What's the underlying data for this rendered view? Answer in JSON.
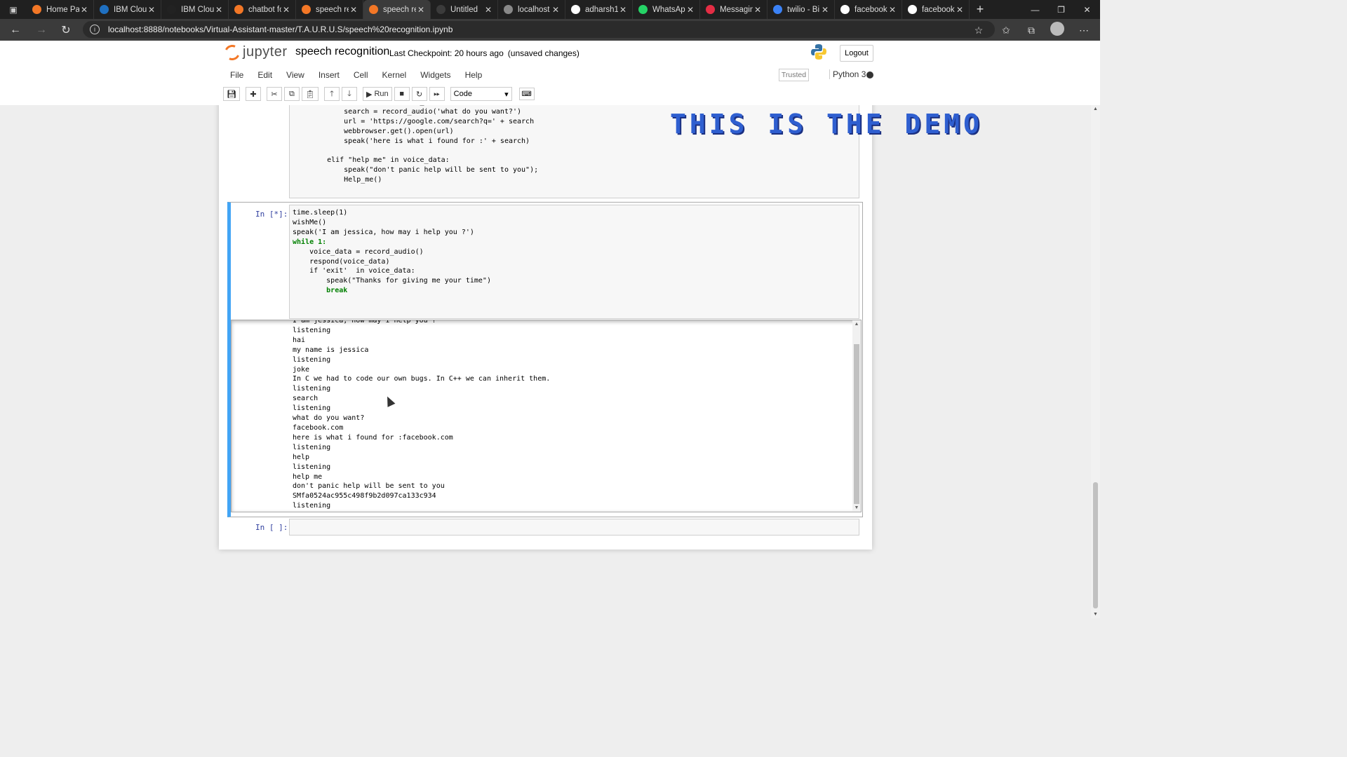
{
  "browser": {
    "tabs": [
      {
        "label": "Home Pa",
        "icon": "jupyter-icon",
        "color": "#f37726",
        "active": false
      },
      {
        "label": "IBM Clou",
        "icon": "ibm-icon",
        "color": "#1f70c1",
        "active": false
      },
      {
        "label": "IBM Clou",
        "icon": "github-icon",
        "color": "#222222",
        "active": false
      },
      {
        "label": "chatbot fo",
        "icon": "jupyter-icon",
        "color": "#f37726",
        "active": false
      },
      {
        "label": "speech re",
        "icon": "notebook-icon",
        "color": "#f37726",
        "active": false
      },
      {
        "label": "speech re",
        "icon": "notebook-icon",
        "color": "#f37726",
        "active": true
      },
      {
        "label": "Untitled",
        "icon": "blank-icon",
        "color": "#3b3b3b",
        "active": false
      },
      {
        "label": "localhost",
        "icon": "page-icon",
        "color": "#888888",
        "active": false
      },
      {
        "label": "adharsh1t",
        "icon": "github-icon",
        "color": "#ffffff",
        "active": false
      },
      {
        "label": "WhatsApp",
        "icon": "whatsapp-icon",
        "color": "#25d366",
        "active": false
      },
      {
        "label": "Messagin",
        "icon": "twilio-icon",
        "color": "#e42d44",
        "active": false
      },
      {
        "label": "twilio - Bi",
        "icon": "bing-icon",
        "color": "#3b82f6",
        "active": false
      },
      {
        "label": "facebook",
        "icon": "google-icon",
        "color": "#ffffff",
        "active": false
      },
      {
        "label": "facebook",
        "icon": "google-icon",
        "color": "#ffffff",
        "active": false
      }
    ],
    "url": "localhost:8888/notebooks/Virtual-Assistant-master/T.A.U.R.U.S/speech%20recognition.ipynb"
  },
  "jupyter": {
    "logo_text": "jupyter",
    "notebook_title": "speech recognition",
    "checkpoint": "Last Checkpoint: 20 hours ago",
    "unsaved": "(unsaved changes)",
    "logout_label": "Logout",
    "menu": [
      "File",
      "Edit",
      "View",
      "Insert",
      "Cell",
      "Kernel",
      "Widgets",
      "Help"
    ],
    "trusted_label": "Trusted",
    "kernel_name": "Python 3",
    "toolbar": {
      "run_label": "Run",
      "cell_type": "Code"
    }
  },
  "overlay_text": "THIS IS THE DEMO",
  "cells": {
    "cell1_code": "    elif 'search' in voice_data:\n        search = record_audio('what do you want?')\n        url = 'https://google.com/search?q=' + search\n        webbrowser.get().open(url)\n        speak('here is what i found for :' + search)\n\n    elif \"help me\" in voice_data:\n        speak(\"don't panic help will be sent to you\");\n        Help_me()",
    "cell2_prompt": "In [*]:",
    "cell2_code": [
      "time.sleep(1)",
      "wishMe()",
      "speak('I am jessica, how may i help you ?')",
      "while 1:",
      "    voice_data = record_audio()",
      "    respond(voice_data)",
      "    if 'exit'  in voice_data:",
      "        speak(\"Thanks for giving me your time\")",
      "        break"
    ],
    "cell2_output": "I am jessica, how may i help you ?\nlistening\nhai\nmy name is jessica\nlistening\njoke\nIn C we had to code our own bugs. In C++ we can inherit them.\nlistening\nsearch\nlistening\nwhat do you want?\nfacebook.com\nhere is what i found for :facebook.com\nlistening\nhelp\nlistening\nhelp me\ndon't panic help will be sent to you\nSMfa0524ac955c498f9b2d097ca133c934\nlistening",
    "cell3_prompt": "In [ ]:"
  }
}
